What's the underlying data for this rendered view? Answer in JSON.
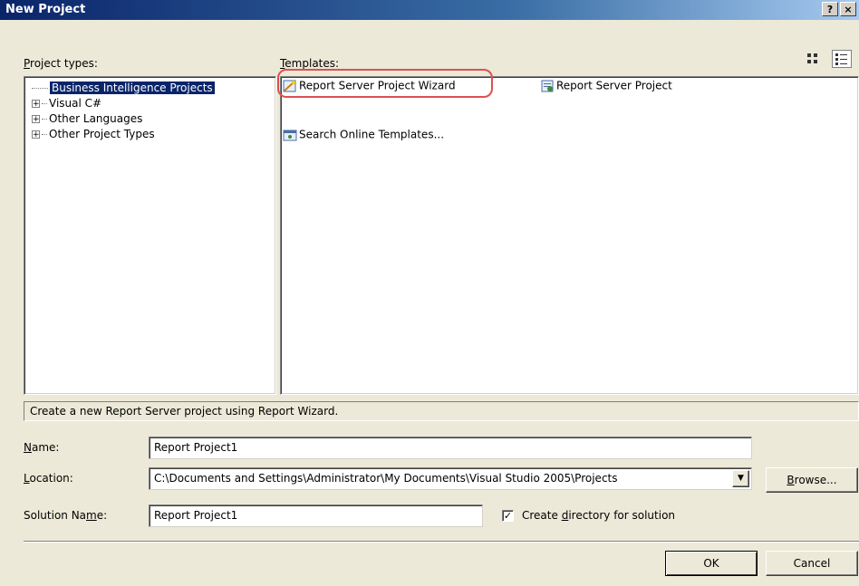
{
  "window": {
    "title": "New Project",
    "help_label": "?",
    "close_label": "×"
  },
  "project_types": {
    "label_underlined": "P",
    "label_rest": "roject types:",
    "items": [
      {
        "label": "Business Intelligence Projects",
        "selected": true,
        "expandable": false
      },
      {
        "label": "Visual C#",
        "expandable": true
      },
      {
        "label": "Other Languages",
        "expandable": true
      },
      {
        "label": "Other Project Types",
        "expandable": true
      }
    ]
  },
  "templates": {
    "label_underlined": "T",
    "label_rest": "emplates:",
    "items": [
      {
        "label": "Report Server Project Wizard",
        "icon": "report-wizard-icon",
        "highlighted": true
      },
      {
        "label": "Report Server Project",
        "icon": "report-project-icon"
      },
      {
        "label": "Search Online Templates...",
        "icon": "search-online-icon"
      }
    ],
    "view_icons": [
      "large-icons-view-icon",
      "small-icons-view-icon"
    ]
  },
  "description": "Create a new Report Server project using Report Wizard.",
  "form": {
    "name_label_u": "N",
    "name_label_rest": "ame:",
    "name_value": "Report Project1",
    "location_label_u": "L",
    "location_label_rest": "ocation:",
    "location_value": "C:\\Documents and Settings\\Administrator\\My Documents\\Visual Studio 2005\\Projects",
    "browse_label_u": "B",
    "browse_label_rest": "rowse...",
    "solution_label_pre": "Solution Na",
    "solution_label_u": "m",
    "solution_label_rest": "e:",
    "solution_value": "Report Project1",
    "create_dir_pre": "Create ",
    "create_dir_u": "d",
    "create_dir_rest": "irectory for solution",
    "create_dir_checked": true
  },
  "buttons": {
    "ok": "OK",
    "cancel": "Cancel"
  },
  "colors": {
    "selection": "#0a246a",
    "highlight_ring": "#e05050",
    "titlebar": "#0a246a"
  }
}
